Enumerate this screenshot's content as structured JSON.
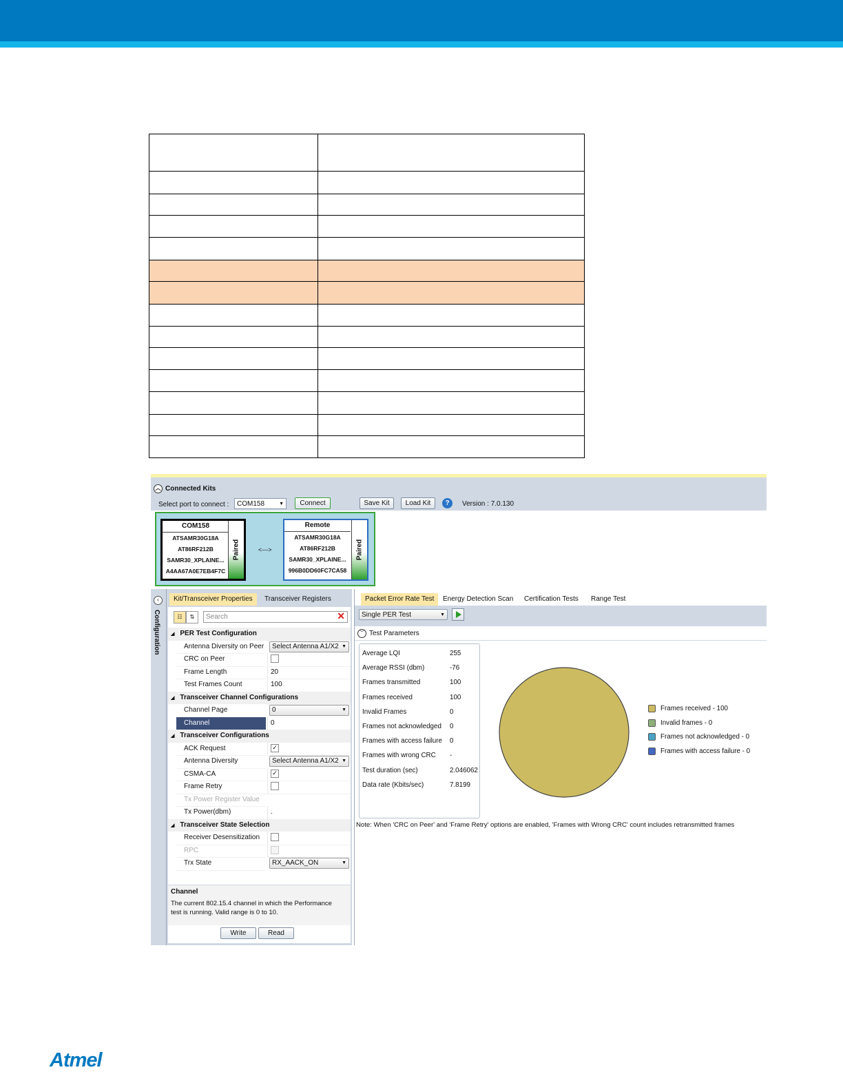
{
  "document": {
    "table_rows": [
      {
        "col1": "",
        "col2": "",
        "highlight": false
      },
      {
        "col1": "",
        "col2": "",
        "highlight": false
      },
      {
        "col1": "",
        "col2": "",
        "highlight": false
      },
      {
        "col1": "",
        "col2": "",
        "highlight": false
      },
      {
        "col1": "",
        "col2": "",
        "highlight": false
      },
      {
        "col1": "",
        "col2": "",
        "highlight": true
      },
      {
        "col1": "",
        "col2": "",
        "highlight": true
      },
      {
        "col1": "",
        "col2": "",
        "highlight": false
      },
      {
        "col1": "",
        "col2": "",
        "highlight": false
      },
      {
        "col1": "",
        "col2": "",
        "highlight": false
      },
      {
        "col1": "",
        "col2": "",
        "highlight": false
      },
      {
        "col1": "",
        "col2": "",
        "highlight": false
      },
      {
        "col1": "",
        "col2": "",
        "highlight": false
      },
      {
        "col1": "",
        "col2": "",
        "highlight": false
      }
    ],
    "logo_text": "Atmel"
  },
  "connected_kits": {
    "title": "Connected Kits",
    "port_label": "Select port to connect :",
    "port_value": "COM158",
    "connect_label": "Connect",
    "save_kit_label": "Save Kit",
    "load_kit_label": "Load Kit",
    "help_glyph": "?",
    "version": "Version : 7.0.130",
    "arrow_text": "<--->",
    "local_kit": {
      "name": "COM158",
      "lines": [
        "ATSAMR30G18A",
        "AT86RF212B",
        "SAMR30_XPLAINE...",
        "A4AA67A0E7EB4F7C"
      ],
      "status": "Paired"
    },
    "remote_kit": {
      "name": "Remote",
      "lines": [
        "ATSAMR30G18A",
        "AT86RF212B",
        "SAMR30_XPLAINE...",
        "996B0DD60FC7CA58"
      ],
      "status": "Paired"
    }
  },
  "configuration": {
    "strip_label": "Configuration",
    "tabs": [
      "Kit/Transceiver Properties",
      "Transceiver Registers"
    ],
    "search_placeholder": "Search",
    "categories": [
      {
        "name": "PER Test Configuration",
        "props": [
          {
            "name": "Antenna Diversity on Peer",
            "type": "dropdown",
            "value": "Select Antenna A1/X2"
          },
          {
            "name": "CRC on Peer",
            "type": "checkbox",
            "checked": false
          },
          {
            "name": "Frame Length",
            "type": "text",
            "value": "20"
          },
          {
            "name": "Test Frames Count",
            "type": "text",
            "value": "100"
          }
        ]
      },
      {
        "name": "Transceiver Channel Configurations",
        "props": [
          {
            "name": "Channel Page",
            "type": "dropdown",
            "value": "0"
          },
          {
            "name": "Channel",
            "type": "text",
            "value": "0",
            "selected": true
          }
        ]
      },
      {
        "name": "Transceiver Configurations",
        "props": [
          {
            "name": "ACK Request",
            "type": "checkbox",
            "checked": true
          },
          {
            "name": "Antenna Diversity",
            "type": "dropdown",
            "value": "Select Antenna A1/X2"
          },
          {
            "name": "CSMA-CA",
            "type": "checkbox",
            "checked": true
          },
          {
            "name": "Frame Retry",
            "type": "checkbox",
            "checked": false
          },
          {
            "name": "Tx Power Register Value",
            "type": "text",
            "value": "",
            "disabled": true
          },
          {
            "name": "Tx Power(dbm)",
            "type": "text",
            "value": "."
          }
        ]
      },
      {
        "name": "Transceiver State Selection",
        "props": [
          {
            "name": "Receiver Desensitization",
            "type": "checkbox",
            "checked": false
          },
          {
            "name": "RPC",
            "type": "checkbox",
            "checked": false,
            "disabled": true
          },
          {
            "name": "Trx State",
            "type": "dropdown",
            "value": "RX_AACK_ON"
          }
        ]
      }
    ],
    "description_title": "Channel",
    "description_body": "The current 802.15.4 channel in which the Performance test is running. Valid range is 0 to 10.",
    "write_label": "Write",
    "read_label": "Read"
  },
  "tests": {
    "tabs": [
      "Packet Error Rate Test",
      "Energy Detection Scan",
      "Certification Tests",
      "Range Test"
    ],
    "mode_value": "Single PER Test",
    "params_label": "Test Parameters",
    "stats": [
      {
        "label": "Average LQI",
        "value": "255"
      },
      {
        "label": "Average RSSI (dbm)",
        "value": "-76"
      },
      {
        "label": "Frames transmitted",
        "value": "100"
      },
      {
        "label": "Frames received",
        "value": "100"
      },
      {
        "label": "Invalid Frames",
        "value": "0"
      },
      {
        "label": "Frames not acknowledged",
        "value": "0"
      },
      {
        "label": "Frames with access failure",
        "value": "0"
      },
      {
        "label": "Frames with wrong CRC",
        "value": "-"
      },
      {
        "label": "Test duration (sec)",
        "value": "2.046062"
      },
      {
        "label": "Data rate (Kbits/sec)",
        "value": "7.8199"
      }
    ],
    "note": "Note: When 'CRC on Peer' and 'Frame Retry' options are enabled, 'Frames with Wrong CRC' count includes retransmitted frames"
  },
  "chart_data": {
    "type": "pie",
    "categories": [
      "Frames received - 100",
      "Invalid frames - 0",
      "Frames not acknowledged - 0",
      "Frames with access failure - 0"
    ],
    "values": [
      100,
      0,
      0,
      0
    ],
    "colors": [
      "#cdbb62",
      "#8fb07a",
      "#4aa3c7",
      "#4467c2"
    ],
    "legend": "right"
  },
  "colors": {
    "header_blue": "#0079c1",
    "header_accent": "#14b4e8",
    "table_highlight": "#fbd4b4",
    "app_panel": "#cfd8e3",
    "active_tab": "#fde7a6"
  }
}
